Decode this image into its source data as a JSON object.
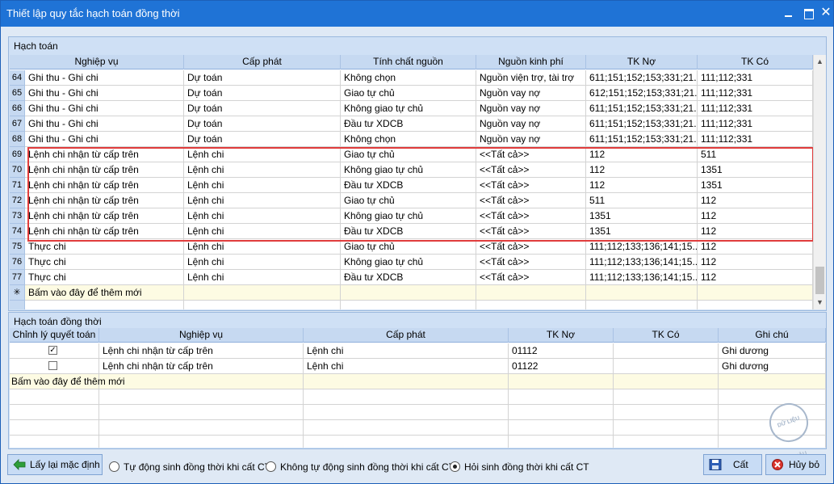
{
  "window": {
    "title": "Thiết lập quy tắc hạch toán đồng thời"
  },
  "top_group": {
    "title": "Hạch toán",
    "columns": [
      "Nghiệp vụ",
      "Cấp phát",
      "Tính chất nguồn",
      "Nguồn kinh phí",
      "TK Nợ",
      "TK Có"
    ],
    "rows": [
      {
        "n": "64",
        "nv": "Ghi thu - Ghi chi",
        "cp": "Dự toán",
        "tc": "Không chọn",
        "nk": "Nguồn viện trợ, tài trợ",
        "no": "611;151;152;153;331;21...",
        "co": "111;112;331"
      },
      {
        "n": "65",
        "nv": "Ghi thu - Ghi chi",
        "cp": "Dự toán",
        "tc": "Giao tự chủ",
        "nk": "Nguồn vay nợ",
        "no": "612;151;152;153;331;21...",
        "co": "111;112;331"
      },
      {
        "n": "66",
        "nv": "Ghi thu - Ghi chi",
        "cp": "Dự toán",
        "tc": "Không giao tự chủ",
        "nk": "Nguồn vay nợ",
        "no": "611;151;152;153;331;21...",
        "co": "111;112;331"
      },
      {
        "n": "67",
        "nv": "Ghi thu - Ghi chi",
        "cp": "Dự toán",
        "tc": "Đầu tư XDCB",
        "nk": "Nguồn vay nợ",
        "no": "611;151;152;153;331;21...",
        "co": "111;112;331"
      },
      {
        "n": "68",
        "nv": "Ghi thu - Ghi chi",
        "cp": "Dự toán",
        "tc": "Không chọn",
        "nk": "Nguồn vay nợ",
        "no": "611;151;152;153;331;21...",
        "co": "111;112;331"
      },
      {
        "n": "69",
        "nv": "Lệnh chi nhận từ cấp trên",
        "cp": "Lệnh chi",
        "tc": "Giao tự chủ",
        "nk": "<<Tất cả>>",
        "no": "112",
        "co": "511"
      },
      {
        "n": "70",
        "nv": "Lệnh chi nhận từ cấp trên",
        "cp": "Lệnh chi",
        "tc": "Không giao tự chủ",
        "nk": "<<Tất cả>>",
        "no": "112",
        "co": "1351"
      },
      {
        "n": "71",
        "nv": "Lệnh chi nhận từ cấp trên",
        "cp": "Lệnh chi",
        "tc": "Đầu tư XDCB",
        "nk": "<<Tất cả>>",
        "no": "112",
        "co": "1351"
      },
      {
        "n": "72",
        "nv": "Lệnh chi nhận từ cấp trên",
        "cp": "Lệnh chi",
        "tc": "Giao tự chủ",
        "nk": "<<Tất cả>>",
        "no": "511",
        "co": "112"
      },
      {
        "n": "73",
        "nv": "Lệnh chi nhận từ cấp trên",
        "cp": "Lệnh chi",
        "tc": "Không giao tự chủ",
        "nk": "<<Tất cả>>",
        "no": "1351",
        "co": "112"
      },
      {
        "n": "74",
        "nv": "Lệnh chi nhận từ cấp trên",
        "cp": "Lệnh chi",
        "tc": "Đầu tư XDCB",
        "nk": "<<Tất cả>>",
        "no": "1351",
        "co": "112"
      },
      {
        "n": "75",
        "nv": "Thực chi",
        "cp": "Lệnh chi",
        "tc": "Giao tự chủ",
        "nk": "<<Tất cả>>",
        "no": "111;112;133;136;141;15...",
        "co": "112"
      },
      {
        "n": "76",
        "nv": "Thực chi",
        "cp": "Lệnh chi",
        "tc": "Không giao tự chủ",
        "nk": "<<Tất cả>>",
        "no": "111;112;133;136;141;15...",
        "co": "112"
      },
      {
        "n": "77",
        "nv": "Thực chi",
        "cp": "Lệnh chi",
        "tc": "Đầu tư XDCB",
        "nk": "<<Tất cả>>",
        "no": "111;112;133;136;141;15...",
        "co": "112"
      }
    ],
    "add_row_symbol": "✳",
    "add_row_text": "Bấm vào đây để thêm mới"
  },
  "bottom_group": {
    "title": "Hạch toán đồng thời",
    "columns": [
      "Chỉnh lý quyết toán",
      "Nghiệp vụ",
      "Cấp phát",
      "TK Nợ",
      "TK Có",
      "Ghi chú"
    ],
    "rows": [
      {
        "checked": true,
        "check_mark": "✓",
        "nv": "Lệnh chi nhận từ cấp trên",
        "cp": "Lệnh chi",
        "no": "01112",
        "co": "",
        "gc": "Ghi dương"
      },
      {
        "checked": false,
        "check_mark": "",
        "nv": "Lệnh chi nhận từ cấp trên",
        "cp": "Lệnh chi",
        "no": "01122",
        "co": "",
        "gc": "Ghi dương"
      }
    ],
    "add_row_text": "Bấm vào đây để thêm mới"
  },
  "footer": {
    "reset_label": "Lấy lại mặc định",
    "radio_options": [
      {
        "label": "Tự động sinh đồng thời khi cất CT",
        "selected": false
      },
      {
        "label": "Không tự động sinh đồng thời khi cất CT",
        "selected": false
      },
      {
        "label": "Hỏi sinh đồng thời khi cất CT",
        "selected": true
      }
    ],
    "save_label": "Cất",
    "cancel_label": "Hủy bỏ"
  },
  "watermark": "DỮ LIỆU MẪU",
  "colors": {
    "titlebar": "#1f73d6",
    "header": "#c6d9f1",
    "highlight": "#e03c3c",
    "add_row": "#fdfbe3"
  }
}
